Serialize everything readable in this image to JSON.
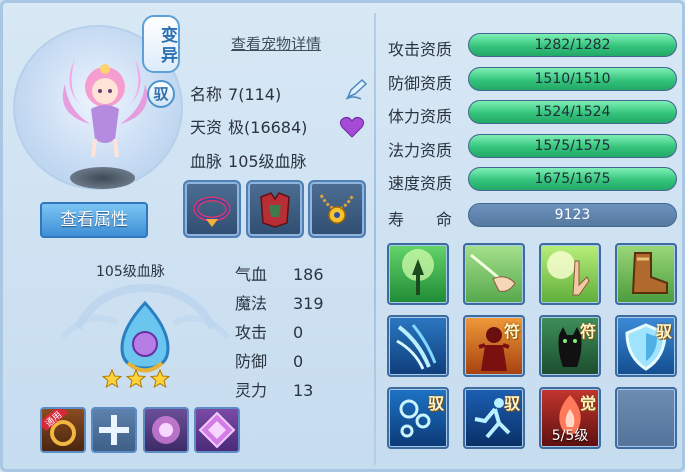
{
  "pet": {
    "mutant_tag": "变异",
    "yu_tag": "驭",
    "view_details_link": "查看宠物详情",
    "name_label": "名称",
    "name_value": "7(114)",
    "talent_label": "天资",
    "talent_value": "极(16684)",
    "bloodline_label": "血脉",
    "bloodline_value": "105级血脉",
    "view_attributes_button": "查看属性"
  },
  "lineage": {
    "title": "105级血脉",
    "stars": 3
  },
  "stats": [
    {
      "label": "气血",
      "value": "186"
    },
    {
      "label": "魔法",
      "value": "319"
    },
    {
      "label": "攻击",
      "value": "0"
    },
    {
      "label": "防御",
      "value": "0"
    },
    {
      "label": "灵力",
      "value": "13"
    }
  ],
  "aptitudes": [
    {
      "label": "攻击资质",
      "value": "1282/1282",
      "fill": 1.0
    },
    {
      "label": "防御资质",
      "value": "1510/1510",
      "fill": 1.0
    },
    {
      "label": "体力资质",
      "value": "1524/1524",
      "fill": 1.0
    },
    {
      "label": "法力资质",
      "value": "1575/1575",
      "fill": 1.0
    },
    {
      "label": "速度资质",
      "value": "1675/1675",
      "fill": 1.0
    }
  ],
  "life": {
    "label": "寿　　命",
    "value": "9123"
  },
  "skill_badges": {
    "fu": "符",
    "yu": "驭",
    "jue": "觉",
    "level": "5/5级"
  },
  "slot_badge": "通用",
  "colors": {
    "bar_fill": "#35c47c",
    "accent_blue": "#3d8fd5",
    "badge_gold": "#fff4c9"
  }
}
